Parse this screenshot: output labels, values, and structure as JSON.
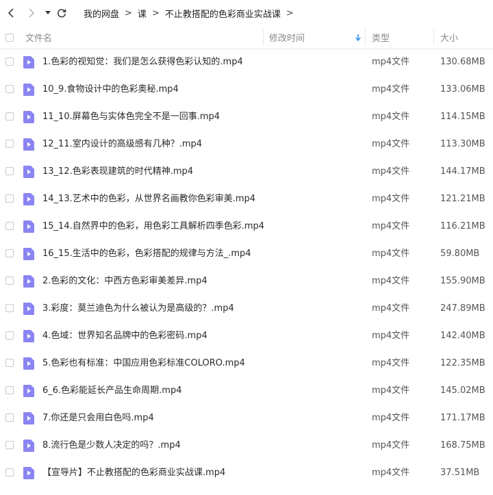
{
  "breadcrumb": [
    "我的网盘",
    "课",
    "不止教搭配的色彩商业实战课"
  ],
  "breadcrumb_separator": ">",
  "columns": {
    "name": "文件名",
    "modified": "修改时间",
    "type": "类型",
    "size": "大小"
  },
  "sort": {
    "column": "modified",
    "direction": "down",
    "arrow_color": "#2b8ef5"
  },
  "icon_color": "#8a85f2",
  "files": [
    {
      "name": "1.色彩的视知觉：我们是怎么获得色彩认知的.mp4",
      "type": "mp4文件",
      "size": "130.68MB"
    },
    {
      "name": "10_9.食物设计中的色彩奥秘.mp4",
      "type": "mp4文件",
      "size": "133.06MB"
    },
    {
      "name": "11_10.屏幕色与实体色完全不是一回事.mp4",
      "type": "mp4文件",
      "size": "114.15MB"
    },
    {
      "name": "12_11.室内设计的高级感有几种？.mp4",
      "type": "mp4文件",
      "size": "113.30MB"
    },
    {
      "name": "13_12.色彩表现建筑的时代精神.mp4",
      "type": "mp4文件",
      "size": "144.17MB"
    },
    {
      "name": "14_13.艺术中的色彩，从世界名画教你色彩审美.mp4",
      "type": "mp4文件",
      "size": "121.21MB"
    },
    {
      "name": "15_14.自然界中的色彩，用色彩工具解析四季色彩.mp4",
      "type": "mp4文件",
      "size": "116.21MB"
    },
    {
      "name": "16_15.生活中的色彩，色彩搭配的规律与方法_.mp4",
      "type": "mp4文件",
      "size": "59.80MB"
    },
    {
      "name": "2.色彩的文化：中西方色彩审美差异.mp4",
      "type": "mp4文件",
      "size": "155.90MB"
    },
    {
      "name": "3.彩度：莫兰迪色为什么被认为是高级的？.mp4",
      "type": "mp4文件",
      "size": "247.89MB"
    },
    {
      "name": "4.色域：世界知名品牌中的色彩密码.mp4",
      "type": "mp4文件",
      "size": "142.40MB"
    },
    {
      "name": "5.色彩也有标准：中国应用色彩标准COLORO.mp4",
      "type": "mp4文件",
      "size": "122.35MB"
    },
    {
      "name": "6_6.色彩能延长产品生命周期.mp4",
      "type": "mp4文件",
      "size": "145.02MB"
    },
    {
      "name": "7.你还是只会用白色吗.mp4",
      "type": "mp4文件",
      "size": "171.17MB"
    },
    {
      "name": "8.流行色是少数人决定的吗？.mp4",
      "type": "mp4文件",
      "size": "168.75MB"
    },
    {
      "name": "【宣导片】不止教搭配的色彩商业实战课.mp4",
      "type": "mp4文件",
      "size": "37.51MB"
    }
  ]
}
